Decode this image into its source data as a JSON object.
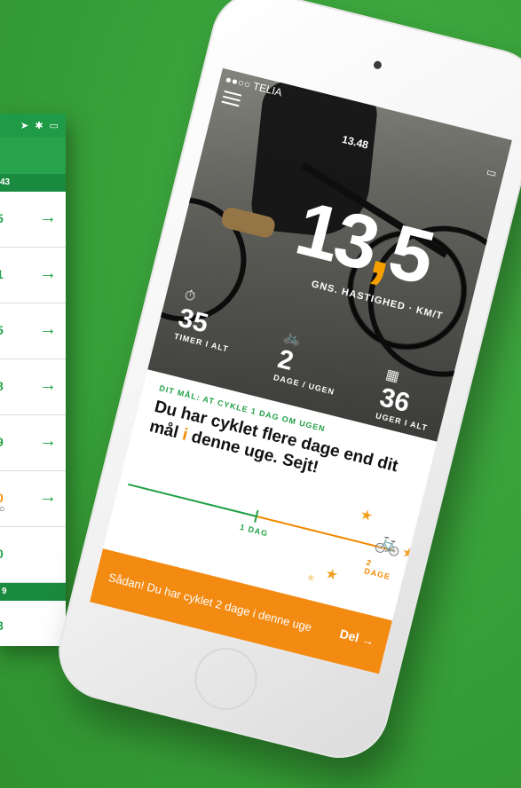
{
  "back_phone": {
    "week_header": "43",
    "rows": [
      {
        "value": "5",
        "sub": ""
      },
      {
        "value": "1",
        "sub": ""
      },
      {
        "value": "5",
        "sub": ""
      },
      {
        "value": "8",
        "sub": ""
      },
      {
        "value": "9",
        "sub": ""
      },
      {
        "value": "0",
        "sub": "D"
      },
      {
        "value": "0",
        "sub": ""
      }
    ],
    "week_header_2": "9",
    "last_value": "8",
    "arrow": "→",
    "colors": {
      "green": "#1fa045",
      "orange": "#f08a00"
    }
  },
  "status_bar": {
    "carrier": "●●○○ TELIA",
    "time": "13.48"
  },
  "speed": {
    "value_main": "13",
    "value_sep": ",",
    "value_decimal": "5",
    "label": "GNS. HASTIGHED · KM/T"
  },
  "stats": [
    {
      "icon": "stopwatch-icon",
      "value": "35",
      "label": "TIMER I ALT"
    },
    {
      "icon": "bike-icon",
      "value": "2",
      "label": "DAGE / UGEN"
    },
    {
      "icon": "calendar-icon",
      "value": "36",
      "label": "UGER I ALT"
    }
  ],
  "goal": {
    "title": "DIT MÅL: AT CYKLE 1 DAG OM UGEN",
    "message_pre": "Du har cyklet flere dage end dit mål ",
    "message_hl": "i",
    "message_post": " denne uge. Sejt!"
  },
  "progress": {
    "marker_label": "1 DAG",
    "end_label": "2 DAGE"
  },
  "banner": {
    "text": "Sådan! Du har cyklet 2 dage i denne uge",
    "button": "Del →"
  },
  "colors": {
    "background": "#3aa33a",
    "accent_orange": "#f38a12",
    "accent_green": "#1fa045"
  }
}
